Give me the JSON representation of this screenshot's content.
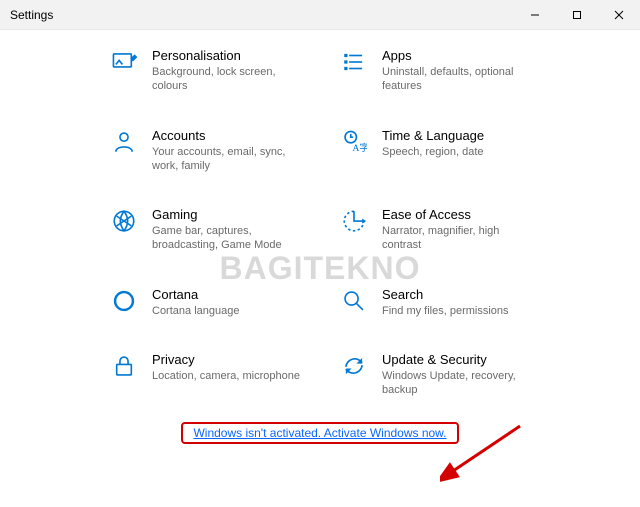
{
  "window": {
    "title": "Settings"
  },
  "colors": {
    "accent": "#0078d4",
    "link": "#0a66ff",
    "highlight": "#d40000",
    "subtext": "#6a6a6a"
  },
  "watermark": "BAGITEKNO",
  "tiles": [
    {
      "id": "personalisation",
      "title": "Personalisation",
      "subtitle": "Background, lock screen, colours",
      "icon": "personalisation-icon"
    },
    {
      "id": "apps",
      "title": "Apps",
      "subtitle": "Uninstall, defaults, optional features",
      "icon": "apps-icon"
    },
    {
      "id": "accounts",
      "title": "Accounts",
      "subtitle": "Your accounts, email, sync, work, family",
      "icon": "accounts-icon"
    },
    {
      "id": "time-language",
      "title": "Time & Language",
      "subtitle": "Speech, region, date",
      "icon": "time-language-icon"
    },
    {
      "id": "gaming",
      "title": "Gaming",
      "subtitle": "Game bar, captures, broadcasting, Game Mode",
      "icon": "gaming-icon"
    },
    {
      "id": "ease-of-access",
      "title": "Ease of Access",
      "subtitle": "Narrator, magnifier, high contrast",
      "icon": "ease-of-access-icon"
    },
    {
      "id": "cortana",
      "title": "Cortana",
      "subtitle": "Cortana language",
      "icon": "cortana-icon"
    },
    {
      "id": "search",
      "title": "Search",
      "subtitle": "Find my files, permissions",
      "icon": "search-icon"
    },
    {
      "id": "privacy",
      "title": "Privacy",
      "subtitle": "Location, camera, microphone",
      "icon": "privacy-icon"
    },
    {
      "id": "update-security",
      "title": "Update & Security",
      "subtitle": "Windows Update, recovery, backup",
      "icon": "update-security-icon"
    }
  ],
  "activation": {
    "text": "Windows isn't activated. Activate Windows now."
  }
}
